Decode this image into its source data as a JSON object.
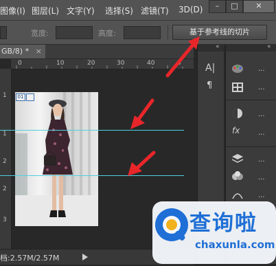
{
  "menubar": {
    "items": [
      "图像(I)",
      "图层(L)",
      "文字(Y)",
      "选择(S)",
      "滤镜(T)",
      "3D(D)"
    ],
    "window_buttons": [
      "–",
      "□",
      "✕"
    ]
  },
  "options": {
    "width_label": "宽度:",
    "height_label": "高度:",
    "slice_button": "基于参考线的切片"
  },
  "document": {
    "tab_label": "GB/8) *",
    "tab_close": "×",
    "ruler_ticks": [
      "0",
      "10",
      "20",
      "30",
      "40",
      "5"
    ],
    "ruler_units": [
      "1",
      "1",
      "2",
      "2",
      "3"
    ],
    "slice_label": "01"
  },
  "status": {
    "doc_size": "档:2.57M/2.57M"
  },
  "panels": {
    "collapse_glyph": "«",
    "more": "..."
  },
  "watermark": {
    "brand": "查询啦",
    "url": "chaxunla.com"
  },
  "colors": {
    "guide": "#4fd0e0",
    "arrow": "#e8262a",
    "brand_blue": "#1f6fd6"
  }
}
